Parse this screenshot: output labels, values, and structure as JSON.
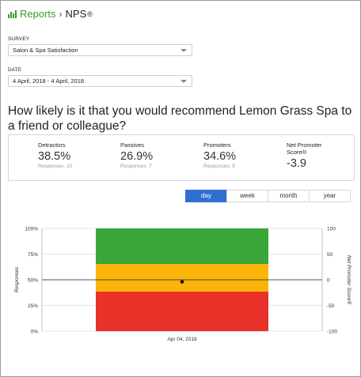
{
  "breadcrumb": {
    "parent": "Reports",
    "separator": "›",
    "current": "NPS",
    "reg_mark": "®"
  },
  "survey": {
    "label": "SURVEY",
    "value": "Salon & Spa Satisfaction"
  },
  "date": {
    "label": "DATE",
    "value": "4 April, 2018 - 4 April, 2018"
  },
  "question": "How likely is it that you would recommend Lemon Grass Spa to a friend or colleague?",
  "stats": [
    {
      "label": "Detractors",
      "value": "38.5%",
      "sub": "Responses: 10"
    },
    {
      "label": "Passives",
      "value": "26.9%",
      "sub": "Responses: 7"
    },
    {
      "label": "Promoters",
      "value": "34.6%",
      "sub": "Responses: 9"
    },
    {
      "label": "Net Promoter Score®",
      "value": "-3.9",
      "sub": ""
    }
  ],
  "periods": [
    "day",
    "week",
    "month",
    "year"
  ],
  "active_period": "day",
  "colors": {
    "accent": "#3a9a2c",
    "active": "#2f6fd1",
    "detractors": "#e8322a",
    "passives": "#fbb40a",
    "promoters": "#3aa63a"
  },
  "chart_data": {
    "type": "bar",
    "categories": [
      "Apr 04, 2018"
    ],
    "series": [
      {
        "name": "Detractors",
        "values": [
          38.5
        ],
        "color": "#e8322a"
      },
      {
        "name": "Passives",
        "values": [
          26.9
        ],
        "color": "#fbb40a"
      },
      {
        "name": "Promoters",
        "values": [
          34.6
        ],
        "color": "#3aa63a"
      }
    ],
    "nps_line": {
      "values": [
        -3.9
      ]
    },
    "ylabel": "Responses",
    "y2label": "Net Promoter Score®",
    "ylim": [
      0,
      100
    ],
    "y2lim": [
      -100,
      100
    ],
    "yticks": [
      "0%",
      "25%",
      "50%",
      "75%",
      "100%"
    ],
    "y2ticks": [
      "-100",
      "-50",
      "0",
      "50",
      "100"
    ],
    "stacked": true,
    "grid": true
  }
}
